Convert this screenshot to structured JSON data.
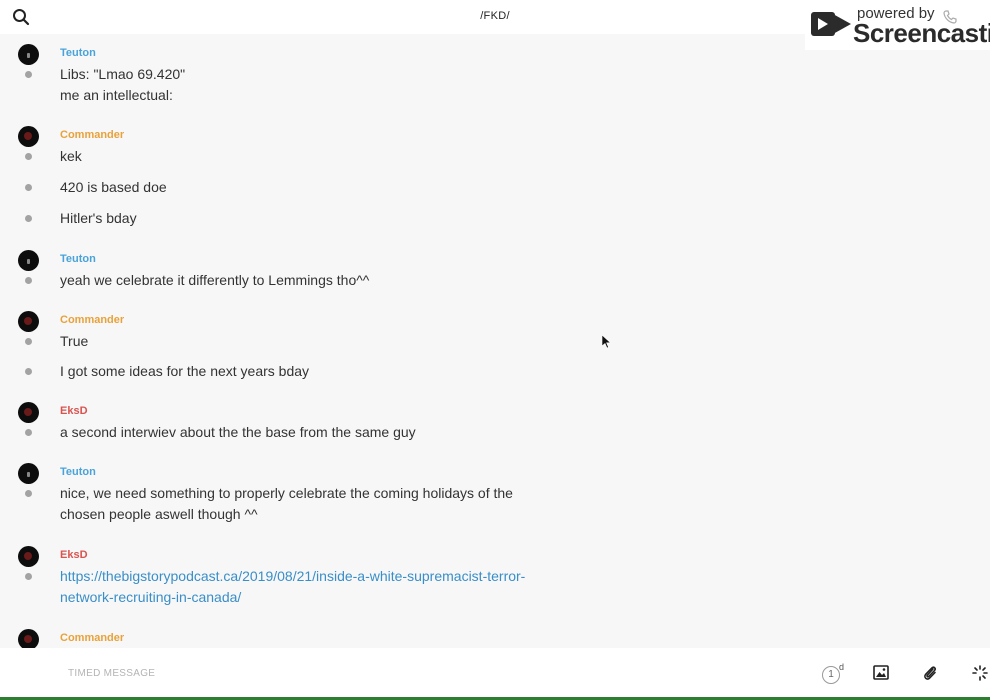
{
  "header": {
    "title": "/FKD/"
  },
  "watermark": {
    "line1": "powered by",
    "brand": "Screencastify"
  },
  "groups": [
    {
      "author": "Teuton",
      "messages": [
        "Libs: \"Lmao 69.420\"",
        "me an intellectual:"
      ]
    },
    {
      "author": "Commander",
      "messages": [
        "kek",
        "420 is based doe",
        "Hitler's bday"
      ]
    },
    {
      "author": "Teuton",
      "messages": [
        "yeah we celebrate it differently to Lemmings tho^^"
      ]
    },
    {
      "author": "Commander",
      "messages": [
        "True",
        "I got some ideas for the next years bday"
      ]
    },
    {
      "author": "EksD",
      "messages": [
        "a second interwiev about the the base from the same guy"
      ]
    },
    {
      "author": "Teuton",
      "messages": [
        "nice, we need something to properly celebrate the coming holidays of the",
        "chosen people aswell though ^^"
      ]
    },
    {
      "author": "EksD",
      "messages": [
        "https://thebigstorypodcast.ca/2019/08/21/inside-a-white-supremacist-terror-",
        "network-recruiting-in-canada/"
      ]
    },
    {
      "author": "Commander",
      "messages": []
    }
  ],
  "composer": {
    "placeholder": "TIMED MESSAGE",
    "timer_value": "1",
    "timer_unit": "d"
  },
  "colors": {
    "teuton": "#4aa3d8",
    "commander": "#e8a23a",
    "eksd": "#d9534f",
    "link": "#3a8ec7"
  },
  "icons": [
    "search-icon",
    "phone-icon",
    "image-icon",
    "attachment-icon",
    "loading-icon",
    "cursor-icon"
  ]
}
